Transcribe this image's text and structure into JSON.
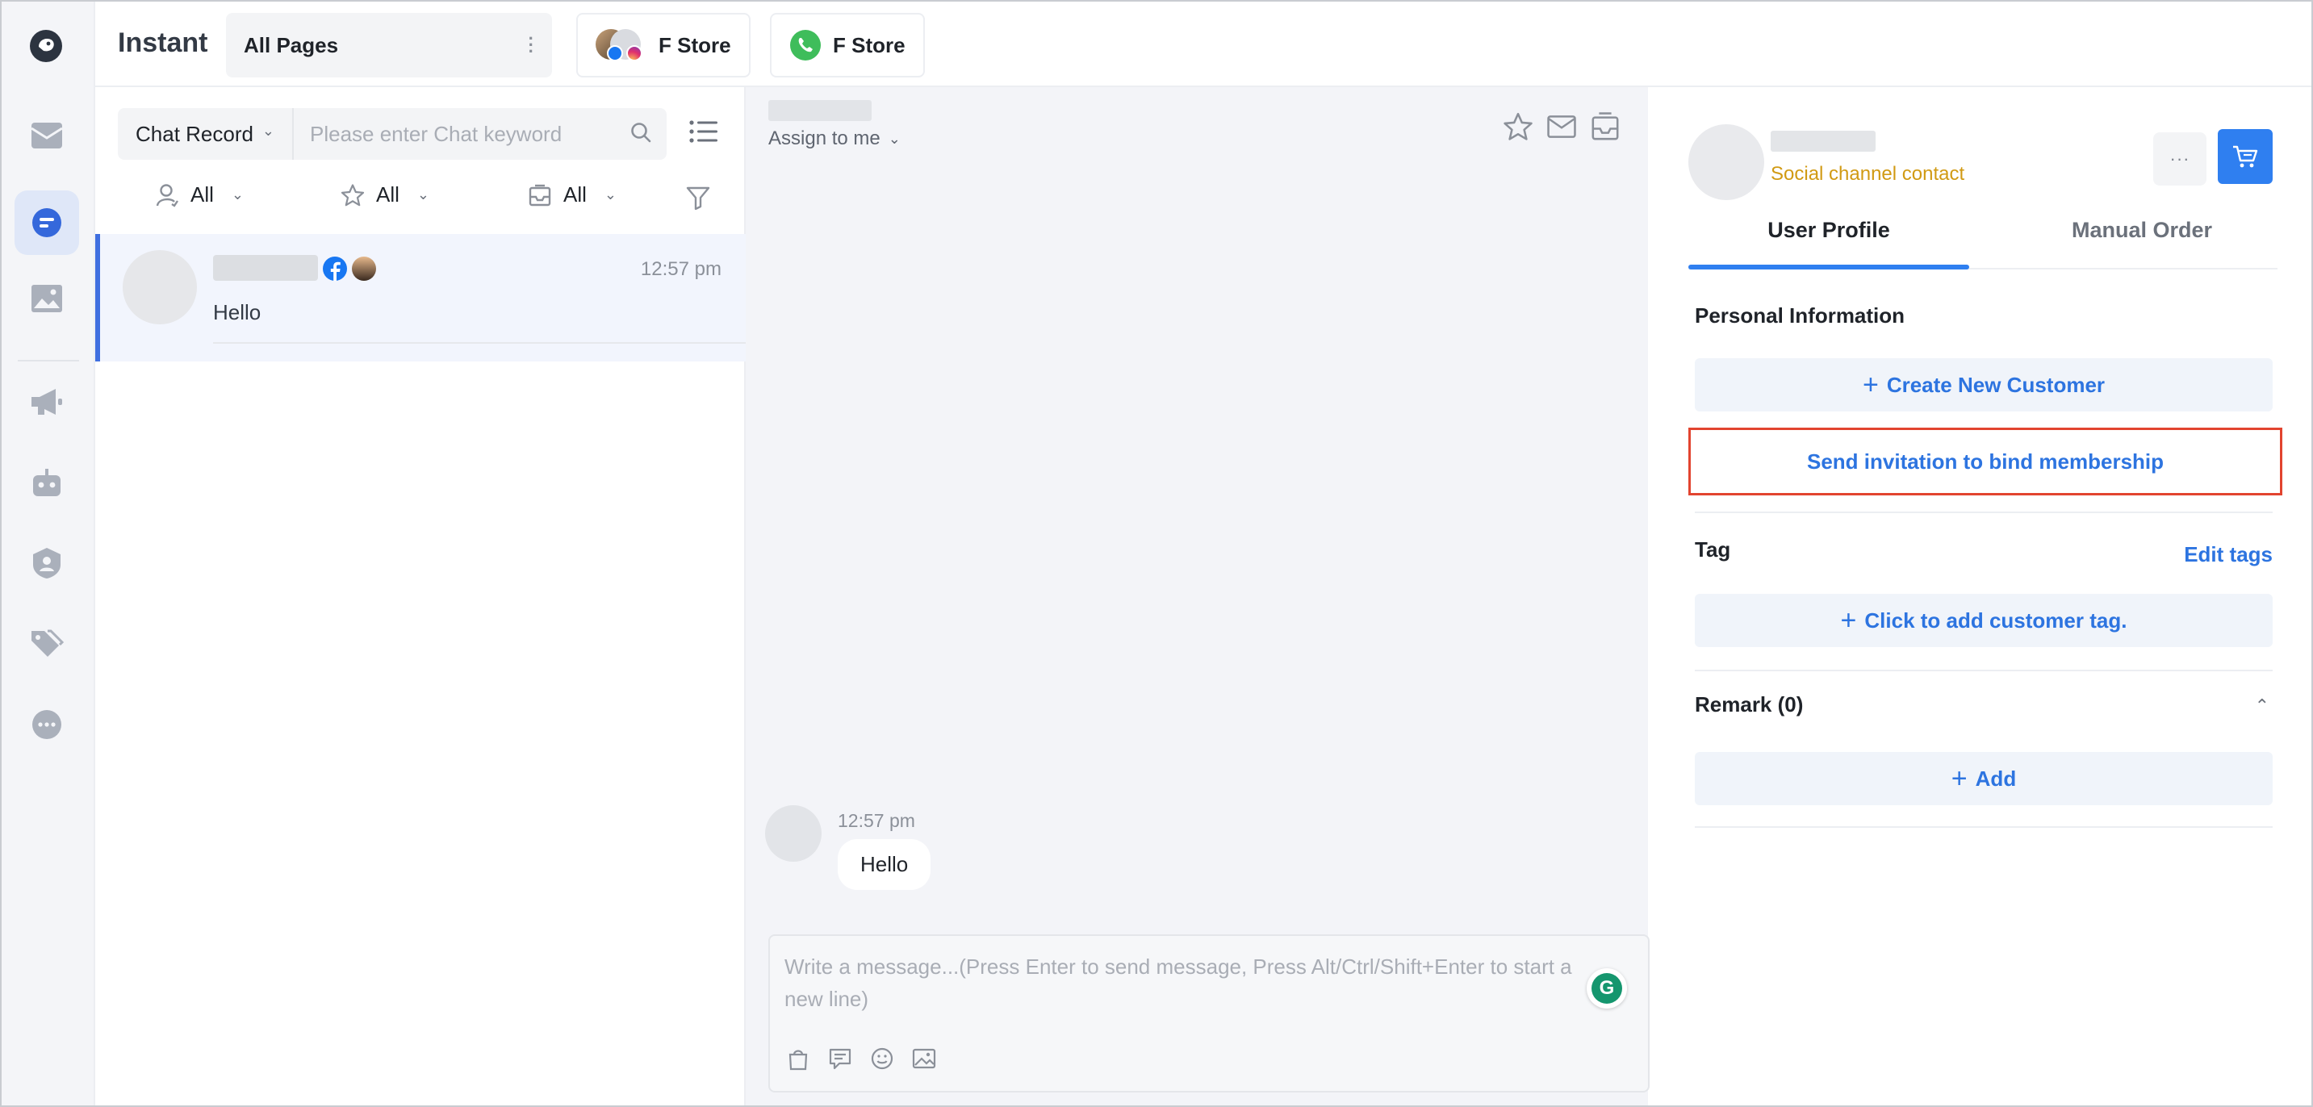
{
  "app": {
    "title": "Instant"
  },
  "colors": {
    "accent": "#2f7ff0",
    "link": "#2d74e0",
    "warning_text": "#d19a13",
    "highlight_border": "#e2442f",
    "active_rail": "#dfe7f8"
  },
  "sidebar": {
    "items": [
      {
        "icon": "inbox-icon"
      },
      {
        "icon": "chat-icon",
        "active": true
      },
      {
        "icon": "image-icon"
      },
      {
        "icon": "megaphone-icon"
      },
      {
        "icon": "robot-icon"
      },
      {
        "icon": "user-shield-icon"
      },
      {
        "icon": "tags-icon"
      },
      {
        "icon": "more-icon"
      }
    ]
  },
  "header": {
    "pages_select": "All Pages",
    "stores": [
      {
        "label": "F Store",
        "channel": "facebook-instagram"
      },
      {
        "label": "F Store",
        "channel": "whatsapp"
      }
    ]
  },
  "chat_list": {
    "search_type": "Chat Record",
    "search_placeholder": "Please enter Chat keyword",
    "filters": [
      {
        "icon": "assignee-icon",
        "label": "All"
      },
      {
        "icon": "star-icon",
        "label": "All"
      },
      {
        "icon": "inbox-icon",
        "label": "All"
      }
    ],
    "conversations": [
      {
        "time": "12:57 pm",
        "message": "Hello"
      }
    ]
  },
  "conversation": {
    "assign_label": "Assign to me",
    "messages": [
      {
        "time": "12:57 pm",
        "text": "Hello"
      }
    ],
    "composer_placeholder": "Write a message...(Press Enter to send message, Press Alt/Ctrl/Shift+Enter to start a new line)",
    "grammarly_label": "G"
  },
  "profile": {
    "subtitle": "Social channel contact",
    "more_label": "···",
    "tabs": [
      {
        "label": "User Profile"
      },
      {
        "label": "Manual Order"
      }
    ],
    "personal_info_title": "Personal Information",
    "create_customer_label": "Create New Customer",
    "invite_label": "Send invitation to bind membership",
    "tag_title": "Tag",
    "edit_tags_label": "Edit tags",
    "add_tag_label": "Click to add customer tag.",
    "remark_title": "Remark (0)",
    "add_remark_label": "Add"
  }
}
